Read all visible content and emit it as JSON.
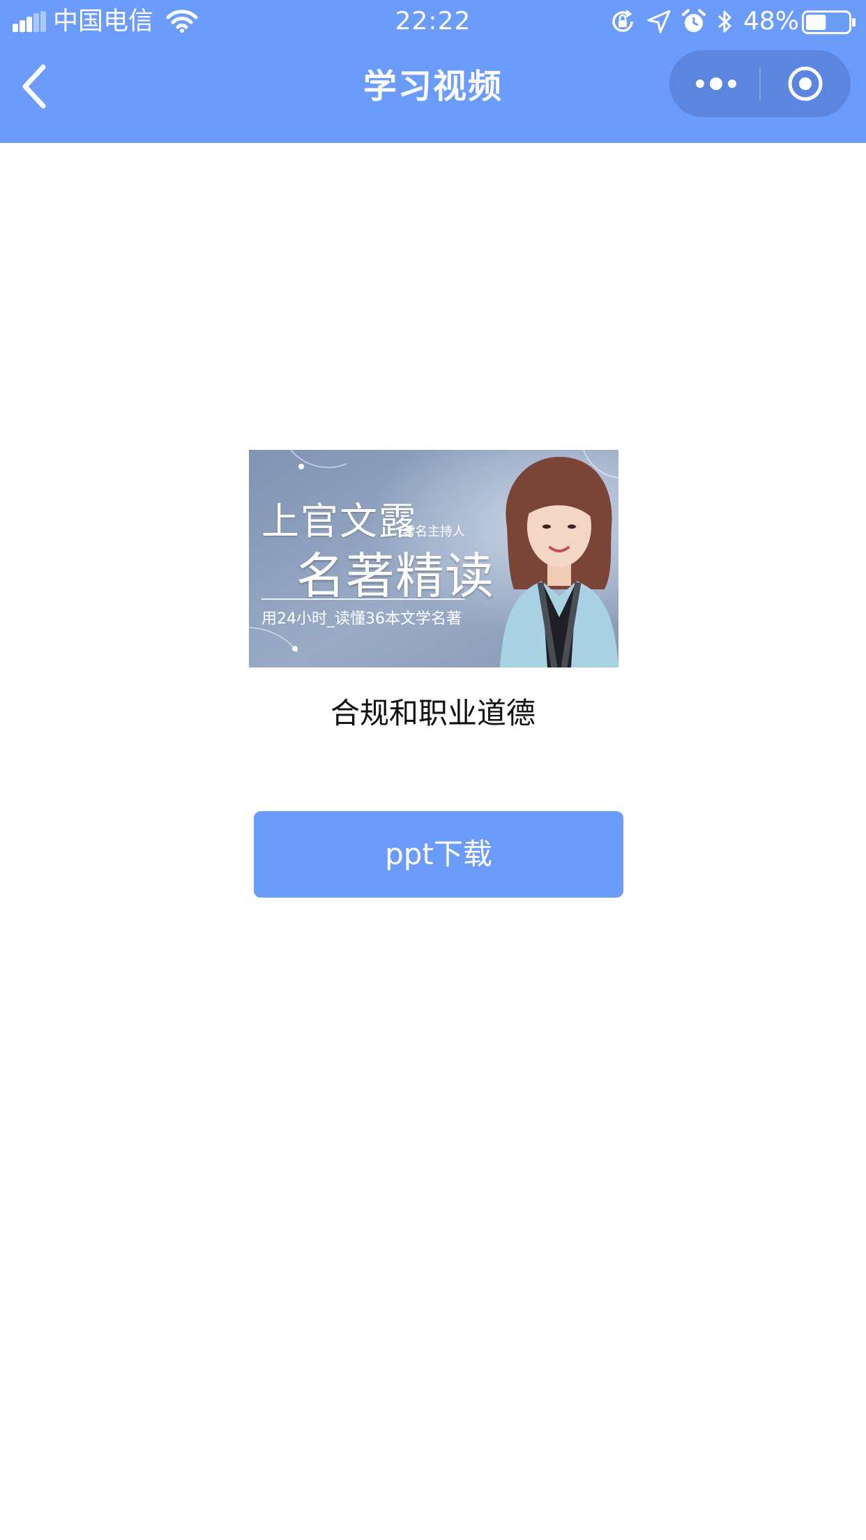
{
  "status_bar": {
    "carrier": "中国电信",
    "time": "22:22",
    "battery_percent": "48%",
    "battery_level": 0.48,
    "icons": [
      "signal-icon",
      "wifi-icon",
      "orientation-lock-icon",
      "location-icon",
      "alarm-icon",
      "bluetooth-icon",
      "battery-icon"
    ]
  },
  "nav": {
    "title": "学习视频",
    "back_icon": "chevron-left-icon",
    "more_icon": "more-dots-icon",
    "close_icon": "target-close-icon"
  },
  "cover": {
    "name": "上官文露",
    "role": "著名主持人",
    "title": "名著精读",
    "subtitle": "用24小时_读懂36本文学名著"
  },
  "video": {
    "title": "合规和职业道德"
  },
  "actions": {
    "download_label": "ppt下载"
  },
  "colors": {
    "primary": "#6b9bfb",
    "capsule": "#5b85de",
    "text": "#111111",
    "background": "#ffffff"
  }
}
